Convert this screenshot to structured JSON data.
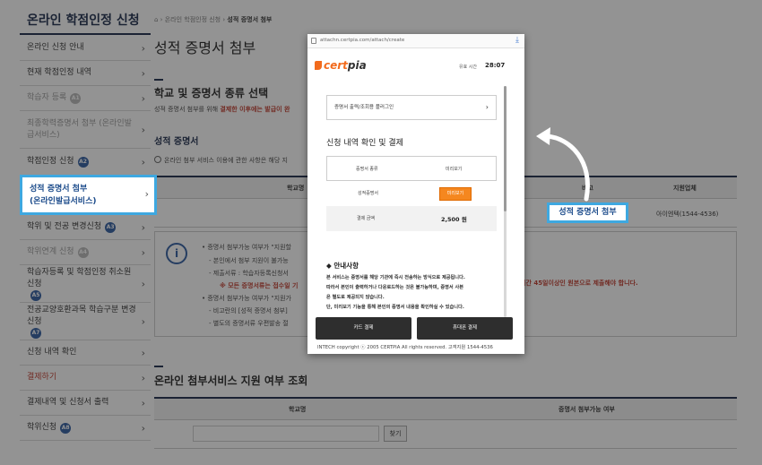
{
  "sidebar": {
    "title": "온라인 학점인정 신청",
    "items": [
      {
        "label": "온라인 신청 안내",
        "badge": "",
        "state": "normal"
      },
      {
        "label": "현재 학점인정 내역",
        "badge": "",
        "state": "normal"
      },
      {
        "label": "학습자 등록",
        "badge": "A1",
        "state": "muted"
      },
      {
        "label": "최종학력증명서 첨부 (온라인발급서비스)",
        "badge": "",
        "state": "muted"
      },
      {
        "label": "학점인정 신청",
        "badge": "A2",
        "state": "normal"
      },
      {
        "label": "성적 증명서 첨부 (온라인발급서비스)",
        "badge": "",
        "state": "active"
      },
      {
        "label": "학위 및 전공 변경신청",
        "badge": "A3",
        "state": "normal"
      },
      {
        "label": "학위연계 신청",
        "badge": "A4",
        "state": "muted"
      },
      {
        "label": "학습자등록 및 학점인정 취소원 신청",
        "badge": "A5",
        "state": "normal"
      },
      {
        "label": "전공교양호환과목 학습구분 변경신청",
        "badge": "A7",
        "state": "normal"
      },
      {
        "label": "신청 내역 확인",
        "badge": "",
        "state": "normal"
      },
      {
        "label": "결제하기",
        "badge": "",
        "state": "red"
      },
      {
        "label": "결제내역 및 신청서 출력",
        "badge": "",
        "state": "normal"
      },
      {
        "label": "학위신청",
        "badge": "A8",
        "state": "normal"
      }
    ],
    "active_line1": "성적 증명서 첨부",
    "active_line2": "(온라인발급서비스)"
  },
  "breadcrumb": {
    "level1": "온라인 학점인정 신청",
    "current": "성적 증명서 첨부"
  },
  "main": {
    "page_title": "성적 증명서 첨부",
    "section1_title": "학교 및 증명서 종류 선택",
    "section1_note_pre": "성적 증명서 첨부를 위해 ",
    "section1_note_red": "결제한 이후에는 발급이 완",
    "subsection": "성적 증명서",
    "agree_text": "온라인 첨부 서비스 이용에 관한 사항은 해당 지",
    "table_headers": {
      "school": "학교명",
      "note": "비고",
      "vendor": "지원업체"
    },
    "table_row": {
      "note_tag": "성적 증명서 첨부",
      "vendor": "아이엔텍(1544-4536)"
    },
    "info_lines": [
      "•  증명서 첨부가능 여부가 \"지원할",
      "-  본인에서 첨부 지원이 불가능",
      "-  제출서류 : 학습자등록신청서",
      "※ 모든 증명서류는 접수일 기",
      "•  증명서 첨부가능 여부가 \"지원가",
      "-  비고란의 [성적 증명서 첨부]",
      "-  별도의 증명서류 우편발송 절"
    ],
    "info_right": "기간 45일이상인 원본으로 제출해야 합니다.",
    "section2_title": "온라인 첨부서비스 지원 여부 조회",
    "table2_headers": {
      "school": "학교명",
      "status": "증명서 첨부가능 여부"
    },
    "find_label": "찾기"
  },
  "popup": {
    "url": "attachn.certpia.com/attach/create",
    "logo_cert": "cert",
    "logo_pia": "pia",
    "timer_label": "유효 시간",
    "timer_value": "28:07",
    "plugin_label": "증명서 출력/조회용 플러그인",
    "heading": "신청 내역 확인 및 결제",
    "col_type": "증명서 종류",
    "col_preview": "미리보기",
    "row_type": "성적증명서",
    "preview_btn": "미리보기",
    "total_label": "결제 금액",
    "total_value": "2,500 원",
    "notice_title": "◆ 안내사항",
    "notice_lines": [
      "본 서비스는 증명서를 해당 기관에 즉시 전송하는 방식으로 제공됩니다.",
      "따라서 본인이 출력하거나 다운로드하는 것은 불가능하며, 증명서 사본",
      "은 별도로 제공되지 않습니다.",
      "단, 미리보기 기능을 통해 본인의 증명서 내용을 확인하실 수 있습니다."
    ],
    "card_btn": "카드 결제",
    "phone_btn": "휴대폰 결제",
    "footer": "INTECH copyright ⓒ 2005 CERTPIA All rights reserved. 고객지원 1544-4536"
  },
  "colors": {
    "accent": "#3ea8e0",
    "navy": "#1a2a4a",
    "brand_orange": "#f26b1d",
    "badge_blue": "#2c5aa0",
    "alert_red": "#c0392b"
  }
}
